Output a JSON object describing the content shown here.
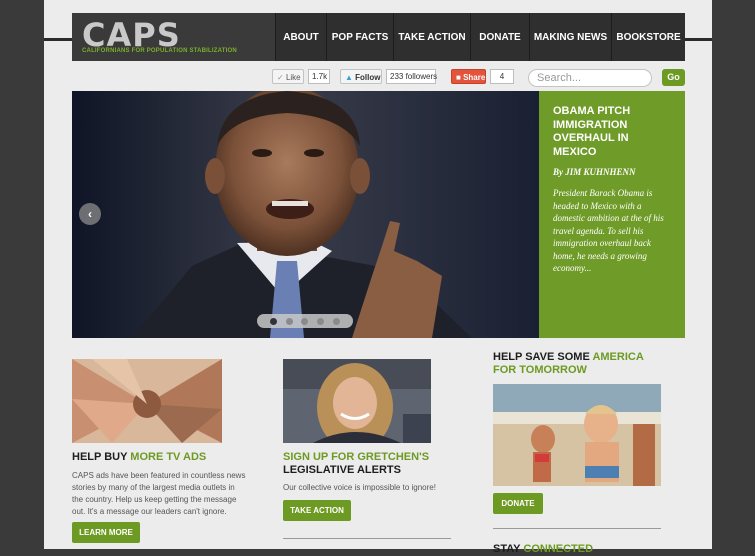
{
  "logo": {
    "title": "CAPS",
    "subtitle": "CALIFORNIANS FOR POPULATION STABILIZATION"
  },
  "nav": [
    {
      "label": "ABOUT"
    },
    {
      "label": "POP FACTS"
    },
    {
      "label": "TAKE ACTION"
    },
    {
      "label": "DONATE"
    },
    {
      "label": "MAKING NEWS"
    },
    {
      "label": "BOOKSTORE"
    }
  ],
  "social": {
    "like_label": "Like",
    "like_count": "1.7k",
    "follow_label": "Follow",
    "followers": "233 followers",
    "share_label": "Share",
    "share_count": "4"
  },
  "search": {
    "placeholder": "Search...",
    "button": "Go"
  },
  "feature": {
    "headline": "OBAMA PITCH IMMIGRATION OVERHAUL IN MEXICO",
    "byline": "By JIM KUHNHENN",
    "excerpt": "President Barack Obama is headed to Mexico with a domestic ambition at the of his travel agenda. To sell his immigration overhaul back home, he needs a growing economy...",
    "slide_count": 5,
    "active_slide": 1
  },
  "columns": {
    "ads": {
      "title_prefix": "HELP BUY ",
      "title_accent": "MORE TV ADS",
      "text": "CAPS ads have been featured in countless news stories by many of the largest media outlets in the country. Help us keep getting the message out. It's a message our leaders can't ignore.",
      "button": "LEARN MORE"
    },
    "alerts": {
      "title_accent": "SIGN UP FOR GRETCHEN'S",
      "title_suffix": "LEGISLATIVE ALERTS",
      "text": "Our collective voice is impossible to ignore!",
      "button": "TAKE ACTION"
    },
    "donate": {
      "title_prefix": "HELP SAVE SOME ",
      "title_accent": "AMERICA",
      "title_line2": "FOR TOMORROW",
      "button": "DONATE"
    }
  },
  "stay_connected": {
    "prefix": "STAY ",
    "accent": "CONNECTED"
  },
  "colors": {
    "accent": "#6d9a23",
    "panel": "#6f9b28",
    "header": "#2f2f2f"
  },
  "icons": {
    "prev": "chevron-left-icon",
    "next": "chevron-right-icon",
    "like": "thumbs-up-icon",
    "follow": "bird-icon",
    "share": "share-icon"
  }
}
